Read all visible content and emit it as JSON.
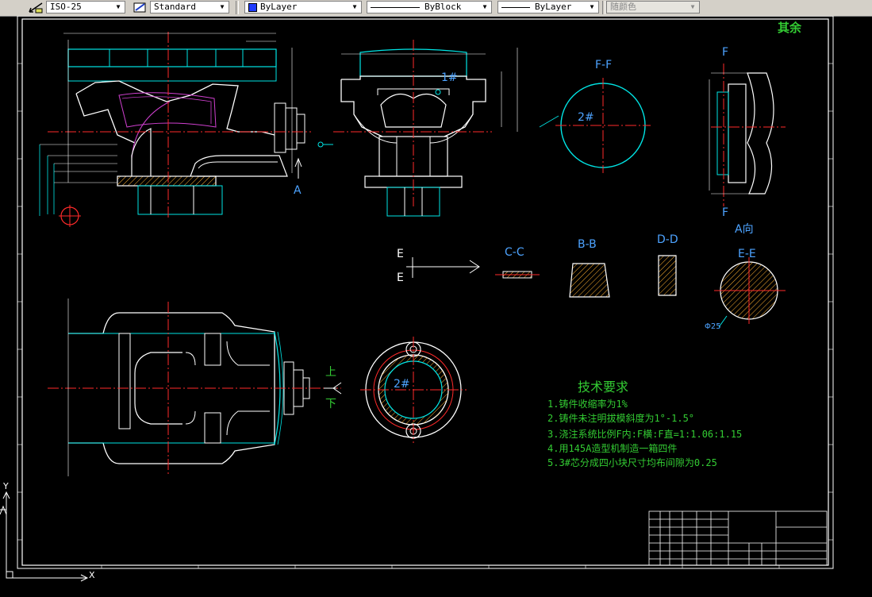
{
  "toolbar": {
    "dimstyle": "ISO-25",
    "textstyle": "Standard",
    "layer": "ByLayer",
    "linetype": "ByBlock",
    "lineweight": "ByLayer",
    "plotstyle": "随颜色"
  },
  "drawing": {
    "corner_text": "其余",
    "views": {
      "ff_title": "F-F",
      "f_top": "F",
      "f_bottom": "F",
      "a_dir": "A向",
      "a_mark": "A",
      "cc": "C-C",
      "bb": "B-B",
      "dd": "D-D",
      "ee": "E-E",
      "e_top": "E",
      "e_bottom": "E",
      "core1": "1#",
      "core2_ff": "2#",
      "core2_ring": "2#",
      "up": "上",
      "down": "下",
      "dim_phi25": "Φ25"
    },
    "tech_title": "技术要求",
    "tech_items": [
      "1.铸件收缩率为1%",
      "2.铸件未注明拔模斜度为1°-1.5°",
      "3.浇注系统比例F内:F横:F直=1:1.06:1.15",
      "4.用145A造型机制造一箱四件",
      "5.3#芯分成四小块尺寸均布间隙为0.25"
    ]
  },
  "ucs": {
    "y": "Y",
    "x": "X"
  }
}
